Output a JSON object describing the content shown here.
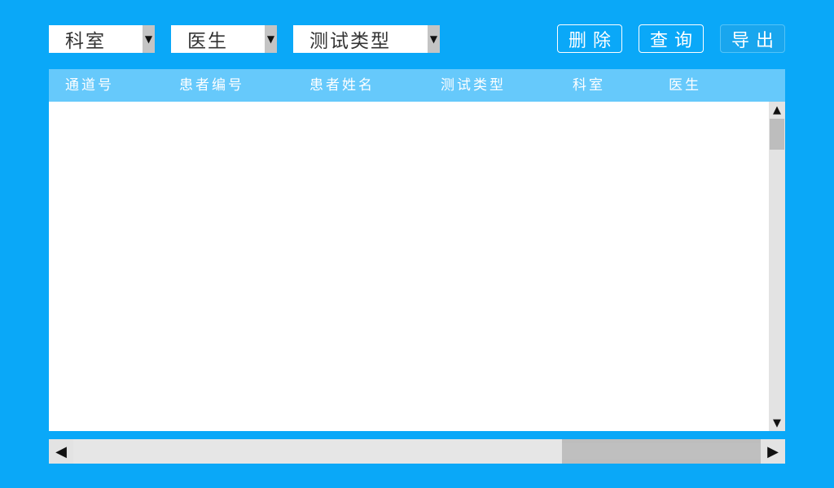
{
  "filters": {
    "department": {
      "label": "科室",
      "arrow": "▼"
    },
    "doctor": {
      "label": "医生",
      "arrow": "▼"
    },
    "test_type": {
      "label": "测试类型",
      "arrow": "▼"
    }
  },
  "actions": {
    "delete": "删除",
    "query": "查询",
    "export": "导出"
  },
  "table": {
    "columns": [
      "通道号",
      "患者编号",
      "患者姓名",
      "测试类型",
      "科室",
      "医生"
    ],
    "rows": []
  },
  "scrollbars": {
    "vertical": {
      "up": "▲",
      "down": "▼"
    },
    "horizontal": {
      "left": "◀",
      "right": "▶"
    }
  },
  "colors": {
    "background": "#0aa8f8",
    "header": "#66c9fb",
    "panel": "#ffffff",
    "scroll_track": "#e3e3e3",
    "scroll_thumb": "#bdbdbd"
  }
}
